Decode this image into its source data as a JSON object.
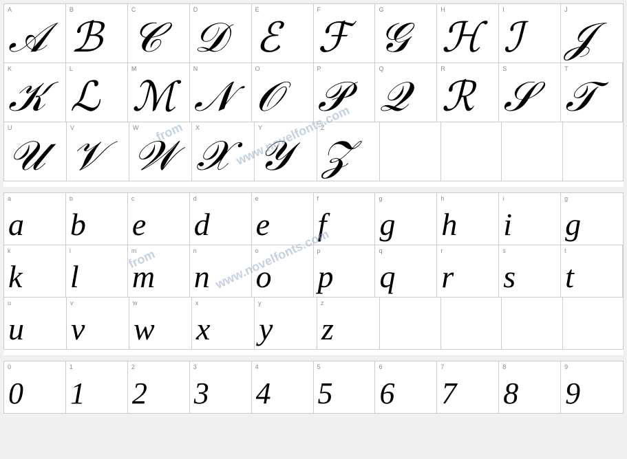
{
  "watermark": {
    "line1": "from",
    "line2": "www.novelfonts.com",
    "line3": "from",
    "line4": "www.novelfonts.com"
  },
  "uppercase": {
    "rows": [
      [
        {
          "label": "A",
          "char": "𝒜"
        },
        {
          "label": "B",
          "char": "ℬ"
        },
        {
          "label": "C",
          "char": "𝒞"
        },
        {
          "label": "D",
          "char": "𝒟"
        },
        {
          "label": "E",
          "char": "ℰ"
        },
        {
          "label": "F",
          "char": "ℱ"
        },
        {
          "label": "G",
          "char": "𝒢"
        },
        {
          "label": "H",
          "char": "ℋ"
        },
        {
          "label": "I",
          "char": "ℐ"
        },
        {
          "label": "J",
          "char": "𝒥"
        }
      ],
      [
        {
          "label": "K",
          "char": "𝒦"
        },
        {
          "label": "L",
          "char": "ℒ"
        },
        {
          "label": "M",
          "char": "ℳ"
        },
        {
          "label": "N",
          "char": "𝒩"
        },
        {
          "label": "O",
          "char": "𝒪"
        },
        {
          "label": "P",
          "char": "𝒫"
        },
        {
          "label": "Q",
          "char": "𝒬"
        },
        {
          "label": "R",
          "char": "ℛ"
        },
        {
          "label": "S",
          "char": "𝒮"
        },
        {
          "label": "T",
          "char": "𝒯"
        }
      ],
      [
        {
          "label": "U",
          "char": "𝒰"
        },
        {
          "label": "V",
          "char": "𝒱"
        },
        {
          "label": "W",
          "char": "𝒲"
        },
        {
          "label": "X",
          "char": "𝒳"
        },
        {
          "label": "Y",
          "char": "𝒴"
        },
        {
          "label": "Z",
          "char": "𝒵"
        }
      ]
    ]
  },
  "lowercase": {
    "rows": [
      [
        {
          "label": "a",
          "char": "a"
        },
        {
          "label": "b",
          "char": "b"
        },
        {
          "label": "c",
          "char": "c"
        },
        {
          "label": "d",
          "char": "d"
        },
        {
          "label": "e",
          "char": "e"
        },
        {
          "label": "f",
          "char": "f"
        },
        {
          "label": "g",
          "char": "g"
        },
        {
          "label": "h",
          "char": "h"
        },
        {
          "label": "i",
          "char": "i"
        },
        {
          "label": "g",
          "char": "g"
        }
      ],
      [
        {
          "label": "k",
          "char": "k"
        },
        {
          "label": "l",
          "char": "l"
        },
        {
          "label": "m",
          "char": "m"
        },
        {
          "label": "n",
          "char": "n"
        },
        {
          "label": "o",
          "char": "o"
        },
        {
          "label": "p",
          "char": "p"
        },
        {
          "label": "q",
          "char": "q"
        },
        {
          "label": "r",
          "char": "r"
        },
        {
          "label": "s",
          "char": "s"
        },
        {
          "label": "t",
          "char": "t"
        }
      ],
      [
        {
          "label": "u",
          "char": "u"
        },
        {
          "label": "v",
          "char": "v"
        },
        {
          "label": "w",
          "char": "w"
        },
        {
          "label": "x",
          "char": "x"
        },
        {
          "label": "y",
          "char": "y"
        },
        {
          "label": "z",
          "char": "z"
        }
      ]
    ]
  },
  "numbers": {
    "rows": [
      [
        {
          "label": "0",
          "char": "0"
        },
        {
          "label": "1",
          "char": "1"
        },
        {
          "label": "2",
          "char": "2"
        },
        {
          "label": "3",
          "char": "3"
        },
        {
          "label": "4",
          "char": "4"
        },
        {
          "label": "5",
          "char": "5"
        },
        {
          "label": "6",
          "char": "6"
        },
        {
          "label": "7",
          "char": "7"
        },
        {
          "label": "8",
          "char": "8"
        },
        {
          "label": "9",
          "char": "9"
        }
      ]
    ]
  }
}
